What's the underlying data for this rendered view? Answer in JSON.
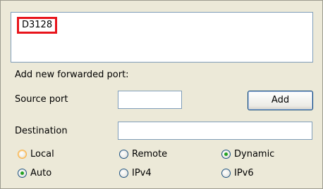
{
  "forwarded_ports": {
    "items": [
      "D3128"
    ]
  },
  "new_port": {
    "section_label": "Add new forwarded port:",
    "source_port_label": "Source port",
    "source_port_value": "",
    "destination_label": "Destination",
    "destination_value": "",
    "add_button": "Add"
  },
  "direction": {
    "local": "Local",
    "remote": "Remote",
    "dynamic": "Dynamic",
    "selected": "Dynamic"
  },
  "ip_version": {
    "auto": "Auto",
    "ipv4": "IPv4",
    "ipv6": "IPv6",
    "selected": "Auto"
  },
  "colors": {
    "highlight_border": "#e8141b",
    "radio_dot": "#21a121"
  }
}
